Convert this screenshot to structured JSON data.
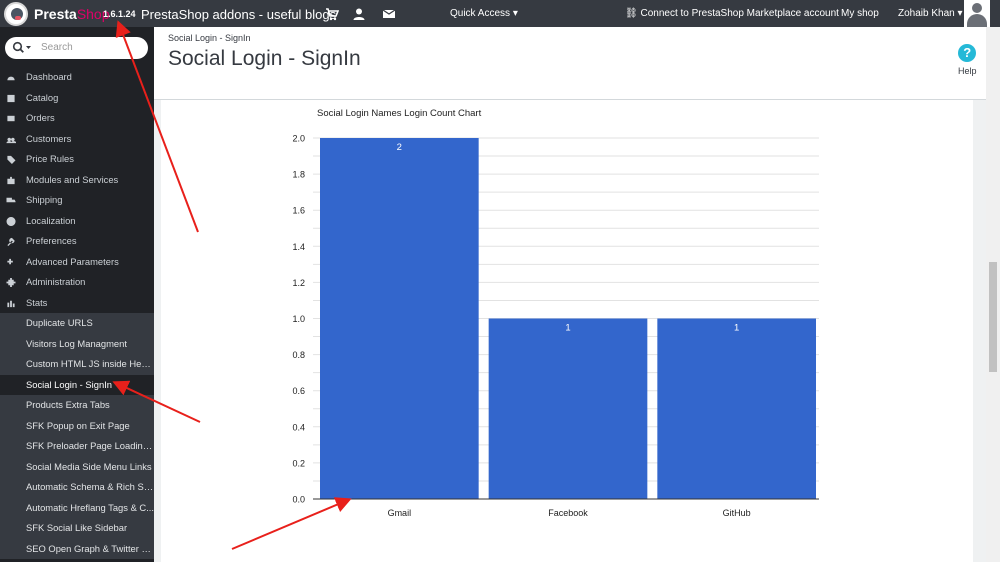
{
  "topbar": {
    "brand_main": "Presta",
    "brand_accent": "Shop",
    "version": "1.6.1.24",
    "shop_name": "PrestaShop addons - useful blogs",
    "icons": [
      "cart-icon",
      "user-icon",
      "envelope-icon"
    ],
    "quick_access": "Quick Access",
    "connect": "Connect to PrestaShop Marketplace account",
    "my_shop": "My shop",
    "user_name": "Zohaib Khan"
  },
  "sidebar": {
    "search_placeholder": "Search",
    "items": [
      {
        "label": "Dashboard",
        "icon": "dashboard-icon"
      },
      {
        "label": "Catalog",
        "icon": "catalog-icon"
      },
      {
        "label": "Orders",
        "icon": "orders-icon"
      },
      {
        "label": "Customers",
        "icon": "customers-icon"
      },
      {
        "label": "Price Rules",
        "icon": "tags-icon"
      },
      {
        "label": "Modules and Services",
        "icon": "puzzle-icon"
      },
      {
        "label": "Shipping",
        "icon": "truck-icon"
      },
      {
        "label": "Localization",
        "icon": "globe-icon"
      },
      {
        "label": "Preferences",
        "icon": "wrench-icon"
      },
      {
        "label": "Advanced Parameters",
        "icon": "cogs-icon"
      },
      {
        "label": "Administration",
        "icon": "gear-icon"
      },
      {
        "label": "Stats",
        "icon": "bar-chart-icon"
      }
    ],
    "subitems": [
      "Duplicate URLS",
      "Visitors Log Managment",
      "Custom HTML JS inside Head...",
      "Social Login - SignIn",
      "Products Extra Tabs",
      "SFK Popup on Exit Page",
      "SFK Preloader Page Loading ...",
      "Social Media Side Menu Links",
      "Automatic Schema & Rich Sn...",
      "Automatic Hreflang Tags & C...",
      "SFK Social Like Sidebar",
      "SEO Open Graph & Twitter C..."
    ],
    "active_subitem": "Social Login - SignIn"
  },
  "header": {
    "breadcrumb": "Social Login - SignIn",
    "title": "Social Login - SignIn",
    "help_label": "Help"
  },
  "colors": {
    "bar": "#3366cc",
    "topbar": "#363a41",
    "sidebar": "#202226",
    "accent": "#df0067",
    "help": "#25b9d7",
    "annotation": "#e8201b"
  },
  "chart_data": {
    "type": "bar",
    "title": "Social Login Names Login Count Chart",
    "categories": [
      "Gmail",
      "Facebook",
      "GitHub"
    ],
    "values": [
      2,
      1,
      1
    ],
    "data_labels": [
      "2",
      "1",
      "1"
    ],
    "ylim": [
      0,
      2
    ],
    "yticks": [
      "0.0",
      "0.2",
      "0.4",
      "0.6",
      "0.8",
      "1.0",
      "1.2",
      "1.4",
      "1.6",
      "1.8",
      "2.0"
    ],
    "xlabel": "",
    "ylabel": "",
    "grid": true,
    "legend": "none"
  }
}
